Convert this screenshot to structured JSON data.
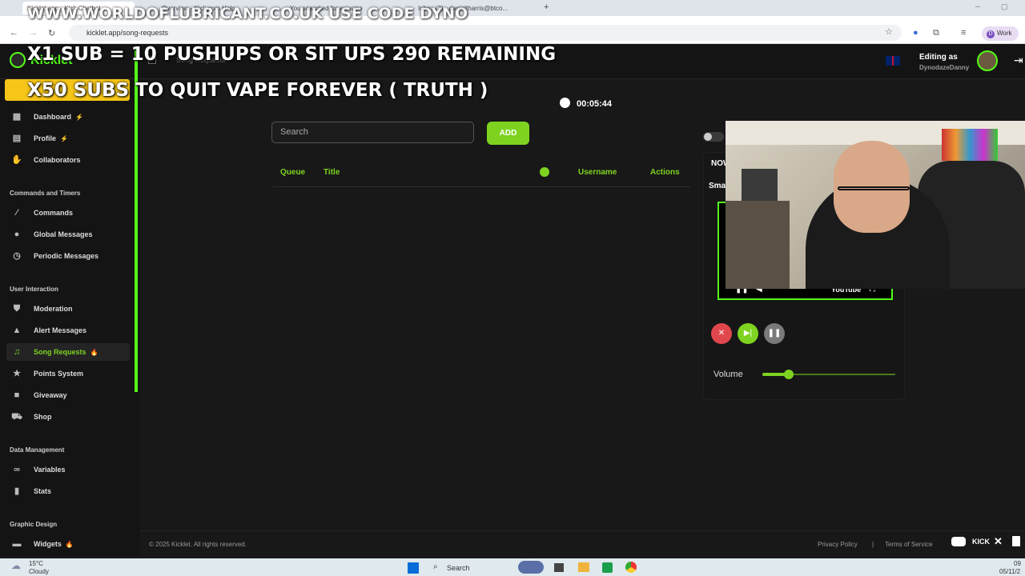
{
  "browser": {
    "tabs": [
      "Kicklet.app - Kick Chatbot",
      "Overview - Kick.com Help",
      "You searched for ex vape",
      "Inbox (3) - danieltharris@btco..."
    ],
    "url": "kicklet.app/song-requests",
    "profile_label": "Work",
    "profile_initial": "D"
  },
  "overlay": {
    "line1": "WWW.WORLDOFLUBRICANT.CO.UK USE CODE DYNO",
    "line2": "X1 SUB = 10 PUSHUPS OR SIT UPS 290 REMAINING",
    "line3": "X50 SUBS TO QUIT VAPE FOREVER ( TRUTH )"
  },
  "header": {
    "brand": "Kicklet",
    "page_title": "Song Requests",
    "editing_as_label": "Editing as",
    "username": "DynodazeDanny"
  },
  "sidebar": {
    "items_top": [
      {
        "label": "Dashboard",
        "badge": "⚡"
      },
      {
        "label": "Profile",
        "badge": "⚡"
      },
      {
        "label": "Collaborators",
        "badge": ""
      }
    ],
    "section_commands": "Commands and Timers",
    "items_commands": [
      {
        "label": "Commands"
      },
      {
        "label": "Global Messages"
      },
      {
        "label": "Periodic Messages"
      }
    ],
    "section_interaction": "User Interaction",
    "items_interaction": [
      {
        "label": "Moderation",
        "badge": ""
      },
      {
        "label": "Alert Messages",
        "badge": ""
      },
      {
        "label": "Song Requests",
        "badge": "🔥"
      },
      {
        "label": "Points System",
        "badge": ""
      },
      {
        "label": "Giveaway",
        "badge": ""
      },
      {
        "label": "Shop",
        "badge": ""
      }
    ],
    "section_data": "Data Management",
    "items_data": [
      {
        "label": "Variables"
      },
      {
        "label": "Stats"
      }
    ],
    "section_graphic": "Graphic Design",
    "items_graphic": [
      {
        "label": "Widgets",
        "badge": "🔥"
      }
    ]
  },
  "main": {
    "timer": "00:05:44",
    "search_placeholder": "Search",
    "add_label": "ADD",
    "columns": [
      "Queue",
      "Title",
      "Username",
      "Actions"
    ]
  },
  "player": {
    "now_label": "NOW",
    "song_title": "Sma",
    "youtube_label": "YouTube",
    "volume_label": "Volume",
    "volume_level": 0.2
  },
  "footer": {
    "copyright": "© 2025 Kicklet. All rights reserved.",
    "privacy": "Privacy Policy",
    "separator": "|",
    "terms": "Terms of Service",
    "kick": "KICK"
  },
  "taskbar": {
    "temp": "15°C",
    "weather": "Cloudy",
    "search": "Search",
    "time": "09",
    "date": "05/11/2"
  },
  "colors": {
    "accent": "#7ed321",
    "kick_green": "#53fc18",
    "stop_red": "#e0474c",
    "pause_grey": "#7a7a7a"
  }
}
